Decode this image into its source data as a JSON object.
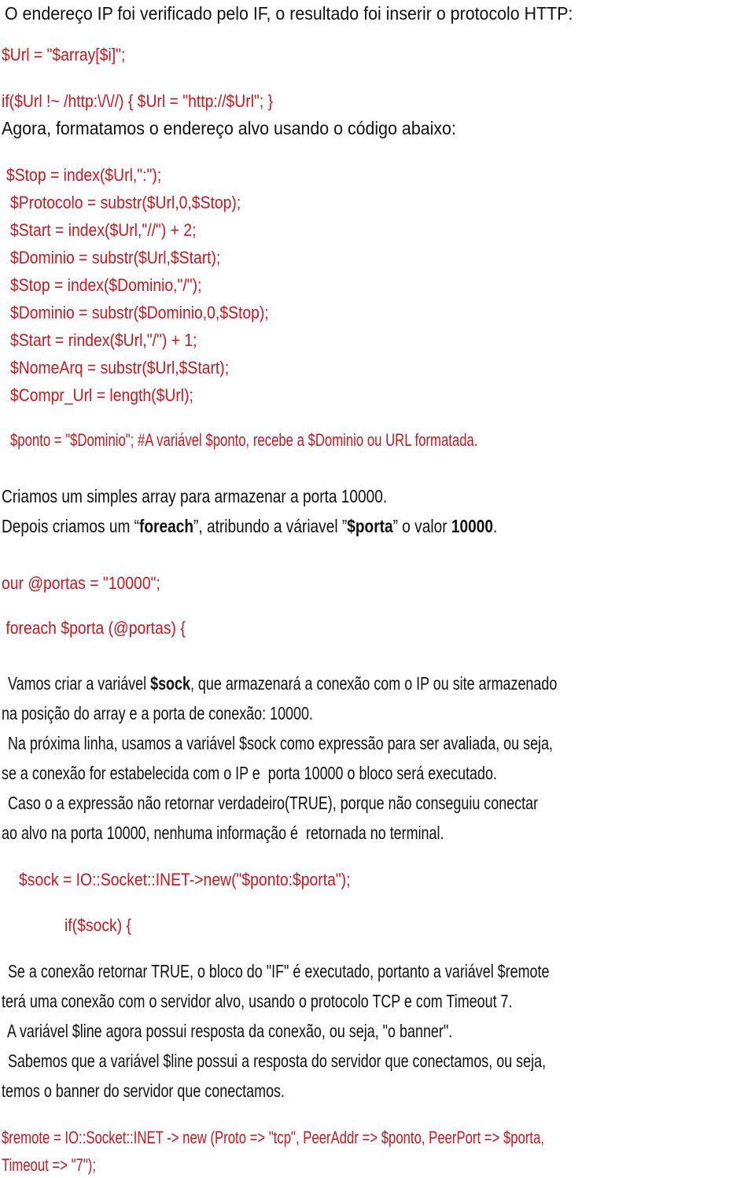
{
  "colors": {
    "text": "#111111",
    "code": "#d0141c",
    "background": "#ffffff"
  },
  "intro": {
    "line1": " O endereço IP foi verificado pelo IF, o resultado foi inserir o protocolo HTTP:",
    "code1": "$Url = \"$array[$i]\";",
    "code2": "if($Url !~ /http:\\/\\//) { $Url = \"http://$Url\"; }",
    "line2": "Agora, formatamos o endereço alvo usando o código abaixo:"
  },
  "format_code": [
    "$Stop = index($Url,\":\");",
    "$Protocolo = substr($Url,0,$Stop);",
    "$Start = index($Url,\"//\") + 2;",
    "$Dominio = substr($Url,$Start);",
    "$Stop = index($Dominio,\"/\");",
    "$Dominio = substr($Dominio,0,$Stop);",
    "$Start = rindex($Url,\"/\") + 1;",
    "$NomeArq = substr($Url,$Start);",
    "$Compr_Url = length($Url);"
  ],
  "ponto_line": "$ponto = \"$Dominio\"; #A variável $ponto, recebe a $Dominio ou URL formatada.",
  "array_para": {
    "line1": "Criamos um simples array para armazenar a porta 10000.",
    "line2_pre": "Depois criamos um “",
    "line2_b1": "foreach",
    "line2_mid1": "”, atribundo a váriavel ”",
    "line2_b2": "$porta",
    "line2_mid2": "” o valor ",
    "line2_b3": "10000",
    "line2_end": "."
  },
  "ports_code": {
    "our": "our @portas = \"10000\";",
    "foreach": " foreach $porta (@portas) {"
  },
  "sock_para": {
    "l1_pre": "  Vamos criar a variável ",
    "l1_b": "$sock",
    "l1_post": ", que armazenará a conexão com o IP ou site armazenado",
    "l2": "na posição do array e a porta de conexão: 10000.",
    "l3": "  Na próxima linha, usamos a variável $sock como expressão para ser avaliada, ou seja,",
    "l4": "se a conexão for estabelecida com o IP e  porta 10000 o bloco será executado.",
    "l5": "  Caso o a expressão não retornar verdadeiro(TRUE), porque não conseguiu conectar",
    "l6": "ao alvo na porta 10000, nenhuma informação é  retornada no terminal."
  },
  "sock_code": {
    "new": "$sock = IO::Socket::INET->new(\"$ponto:$porta\");",
    "if": "if($sock) {"
  },
  "remote_para": [
    "  Se a conexão retornar TRUE, o bloco do \"IF\" é executado, portanto a variável $remote",
    "terá uma conexão com o servidor alvo, usando o protocolo TCP e com Timeout 7.",
    "  A variável $line agora possui resposta da conexão, ou seja, \"o banner\".",
    "  Sabemos que a variável $line possui a resposta do servidor que conectamos, ou seja,",
    "temos o banner do servidor que conectamos."
  ],
  "remote_code": [
    "$remote = IO::Socket::INET -> new (Proto => \"tcp\", PeerAddr => $ponto, PeerPort => $porta,",
    "Timeout => \"7\");"
  ]
}
